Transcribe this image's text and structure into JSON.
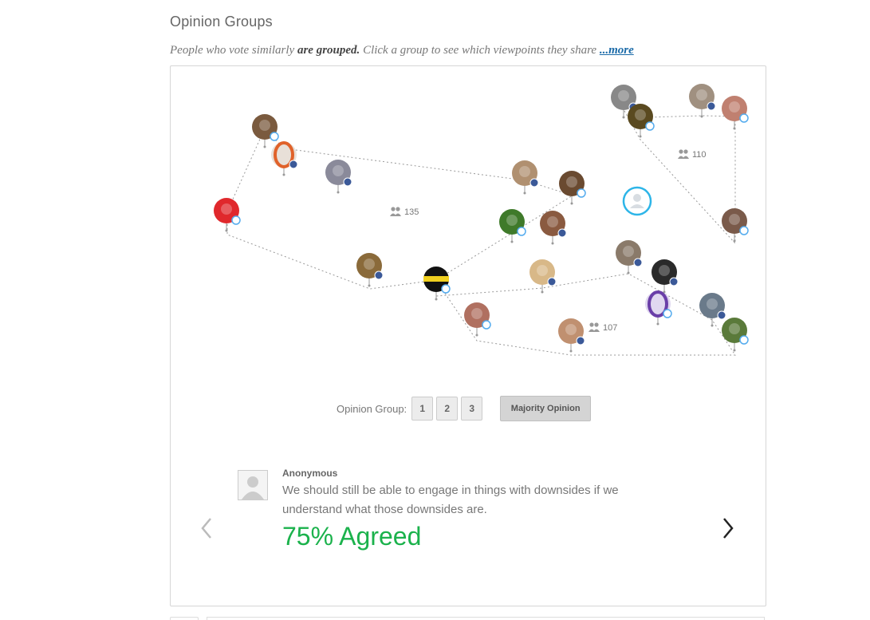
{
  "section": {
    "title": "Opinion Groups",
    "subtitle_prefix": "People who vote similarly ",
    "subtitle_bold": "are grouped.",
    "subtitle_rest": " Click a group to see which viewpoints they share ",
    "subtitle_more": "...more"
  },
  "groups": [
    {
      "count": "135"
    },
    {
      "count": "110"
    },
    {
      "count": "107"
    }
  ],
  "group_selector": {
    "label": "Opinion Group:",
    "buttons": [
      "1",
      "2",
      "3"
    ],
    "majority_label": "Majority Opinion"
  },
  "comment": {
    "author": "Anonymous",
    "text": "We should still be able to engage in things with downsides if we understand what those downsides are.",
    "agreed": "75% Agreed"
  },
  "icons": {
    "group_icon": "people-icon",
    "prev": "chevron-left-icon",
    "next": "chevron-right-icon",
    "anon_avatar": "user-silhouette-icon",
    "self": "self-user-icon"
  },
  "colors": {
    "agreed": "#1bb24c",
    "facebook": "#3b5998",
    "twitter": "#55acee",
    "self_ring": "#2db5e8"
  }
}
